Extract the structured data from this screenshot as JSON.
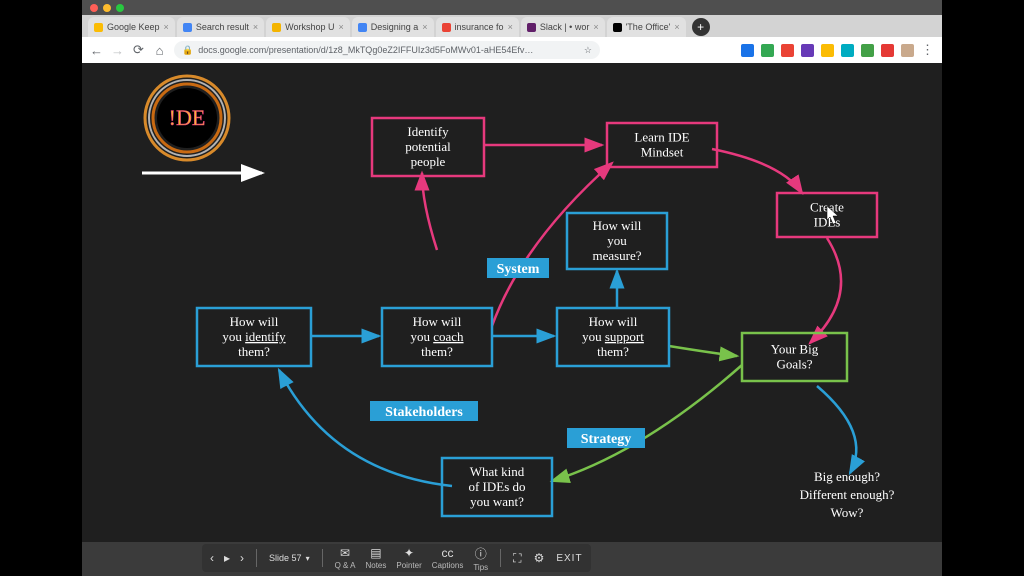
{
  "tabs": [
    {
      "label": "Google Keep",
      "fav": "#fbbc04"
    },
    {
      "label": "Search result",
      "fav": "#4285f4"
    },
    {
      "label": "Workshop U",
      "fav": "#f4b400"
    },
    {
      "label": "Designing a",
      "fav": "#4285f4"
    },
    {
      "label": "insurance fo",
      "fav": "#ea4335"
    },
    {
      "label": "Slack | • wor",
      "fav": "#611f69"
    },
    {
      "label": "'The Office'",
      "fav": "#000"
    }
  ],
  "url": "docs.google.com/presentation/d/1z8_MkTQg0eZ2IFFUIz3d5FoMWv01-aHE54Efv…",
  "diagram": {
    "nodes": {
      "identify_people": {
        "lines": [
          "Identify",
          "potential",
          "people"
        ]
      },
      "learn_mindset": {
        "lines": [
          "Learn IDE",
          "Mindset"
        ]
      },
      "create_ides": {
        "lines": [
          "Create",
          "IDEs"
        ]
      },
      "measure": {
        "lines": [
          "How will",
          "you",
          "measure?"
        ]
      },
      "identify_them": {
        "lines": [
          "How will",
          "you identify",
          "them?"
        ]
      },
      "coach_them": {
        "lines": [
          "How will",
          "you coach",
          "them?"
        ]
      },
      "support_them": {
        "lines": [
          "How will",
          "you support",
          "them?"
        ]
      },
      "big_goals": {
        "lines": [
          "Your Big",
          "Goals?"
        ]
      },
      "what_kind": {
        "lines": [
          "What kind",
          "of IDEs do",
          "you want?"
        ]
      }
    },
    "tags": {
      "system": "System",
      "stakeholders": "Stakeholders",
      "strategy": "Strategy"
    },
    "freetext": [
      "Big enough?",
      "Different enough?",
      "Wow?"
    ]
  },
  "toolbar": {
    "slide": "Slide 57",
    "items": {
      "qa": "Q & A",
      "notes": "Notes",
      "pointer": "Pointer",
      "captions": "Captions",
      "tips": "Tips"
    },
    "exit": "EXIT"
  },
  "colors": {
    "pink": "#e6397d",
    "blue": "#2a9fd6",
    "green": "#79c24b"
  }
}
